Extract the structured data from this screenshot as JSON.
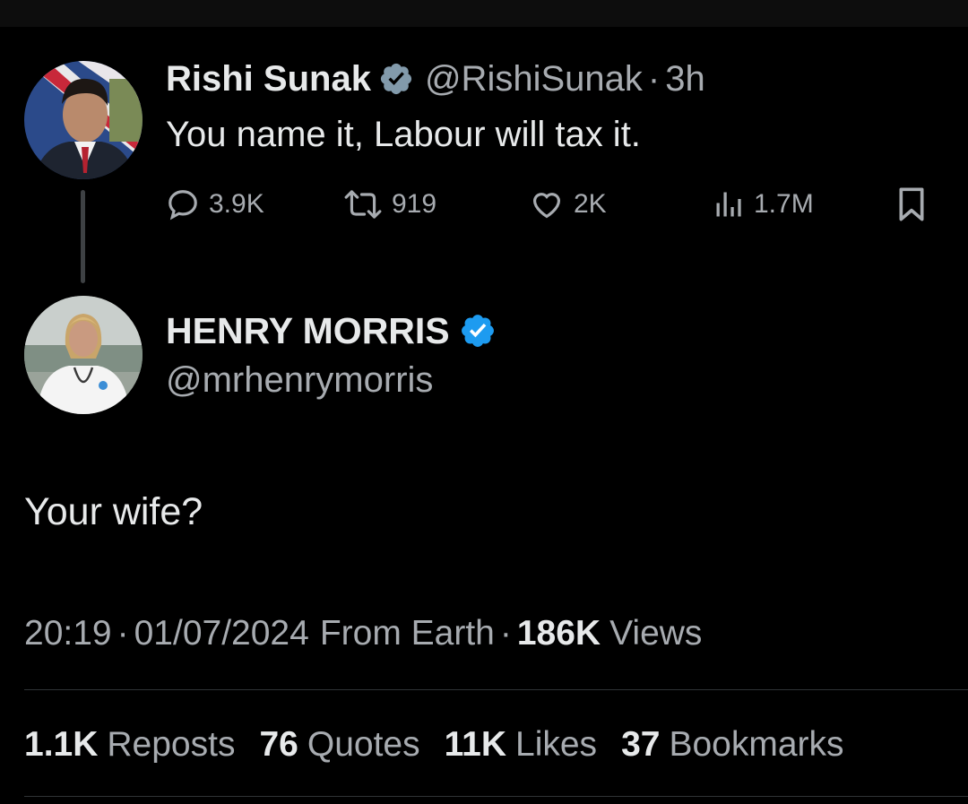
{
  "parent_tweet": {
    "author_name": "Rishi Sunak",
    "handle": "@RishiSunak",
    "separator": "·",
    "time_ago": "3h",
    "verified_badge": "verified-gray-badge-icon",
    "text": "You name it, Labour will tax it.",
    "actions": {
      "replies": "3.9K",
      "reposts": "919",
      "likes": "2K",
      "views": "1.7M"
    }
  },
  "reply_tweet": {
    "author_name": "HENRY MORRIS",
    "handle": "@mrhenrymorris",
    "verified_badge": "verified-blue-badge-icon",
    "text": "Your wife?",
    "meta": {
      "time": "20:19",
      "separator": "·",
      "date": "01/07/2024",
      "source": "From Earth",
      "views_count": "186K",
      "views_label": "Views"
    },
    "stats": [
      {
        "count": "1.1K",
        "label": "Reposts"
      },
      {
        "count": "76",
        "label": "Quotes"
      },
      {
        "count": "11K",
        "label": "Likes"
      },
      {
        "count": "37",
        "label": "Bookmarks"
      }
    ]
  },
  "colors": {
    "background": "#000000",
    "primary_text": "#e7e9ea",
    "secondary_text": "#a7abb0",
    "verified_blue": "#1d9bf0",
    "verified_gray": "#829aab",
    "divider": "#2f3336"
  }
}
